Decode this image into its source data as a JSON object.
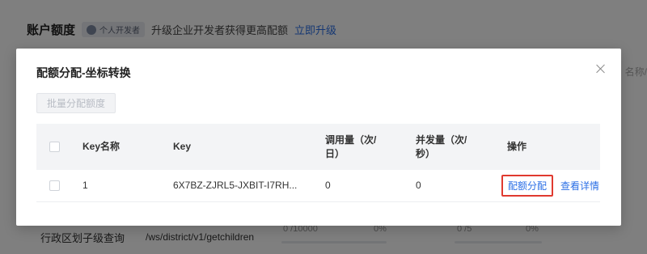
{
  "background": {
    "title": "账户额度",
    "badge": "个人开发者",
    "upgrade_text": "升级企业开发者获得更高配额",
    "upgrade_link": "立即升级",
    "search_fragment": "名称/",
    "row": {
      "name": "行政区划子级查询",
      "path": "/ws/district/v1/getchildren",
      "quota1": "0 /10000",
      "pct1": "0%",
      "quota2": "0 /5",
      "pct2": "0%"
    }
  },
  "modal": {
    "title": "配额分配-坐标转换",
    "batch_button": "批量分配额度",
    "columns": {
      "name": "Key名称",
      "key": "Key",
      "calls_line1": "调用量（次/",
      "calls_line2": "日）",
      "concurrency_line1": "并发量（次/",
      "concurrency_line2": "秒）",
      "ops": "操作"
    },
    "rows": [
      {
        "name": "1",
        "key": "6X7BZ-ZJRL5-JXBIT-I7RH...",
        "calls": "0",
        "concurrency": "0",
        "op_allocate": "配额分配",
        "op_detail": "查看详情"
      }
    ]
  },
  "colors": {
    "accent": "#2b6fe6",
    "highlight_border": "#e03a2f"
  }
}
